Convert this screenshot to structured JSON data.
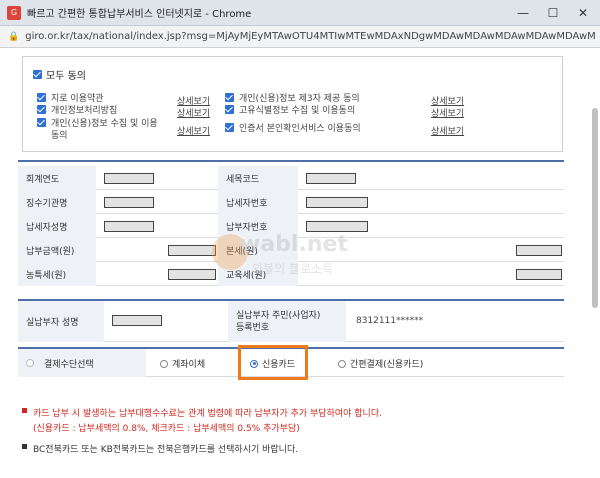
{
  "window": {
    "title": "빠르고 간편한 통합납부서비스 인터넷지로 - Chrome",
    "minimize": "—",
    "maximize": "☐",
    "close": "✕"
  },
  "address_bar": {
    "url": "giro.or.kr/tax/national/index.jsp?msg=MjAyMjEyMTAwOTU4MTIwMTEwMDAxNDgwMDAwMDAwMDAwMDAwMDAwMDAw..."
  },
  "agreement": {
    "all_label": "모두 동의",
    "detail_label": "상세보기",
    "terms_left": [
      "지로 이용약관",
      "개인정보처리방침",
      "개인(신용)정보 수집 및 이용\n동의"
    ],
    "terms_right": [
      "개인(신용)정보 제3자 제공 동의",
      "고유식별정보 수집 및 이용동의",
      "인증서 본인확인서비스 이용동의"
    ]
  },
  "info": {
    "fiscal_year": "회계연도",
    "tax_code": "세목코드",
    "collecting_org": "징수기관명",
    "taxpayer_no": "납세자번호",
    "taxpayer_name": "납세자성명",
    "payment_no": "납부자번호",
    "amount": "납부금액(원)",
    "principal_tax": "본세(원)",
    "rural_tax": "농특세(원)",
    "education_tax": "교육세(원)"
  },
  "payer": {
    "name_label": "실납부자 성명",
    "id_label": "실납부자 주민(사업자)\n등록번호",
    "id_value": "8312111******"
  },
  "payment_method": {
    "label": "결제수단선택",
    "options": [
      "계좌이체",
      "신용카드",
      "간편결제(신용카드)"
    ],
    "selected": "신용카드"
  },
  "notes": {
    "line1": "카드 납부 시 발생하는 납부대행수수료는 관계 법령에 따라 납부자가 추가 부담하여야 합니다.",
    "line2": "(신용카드 : 납부세액의 0.8%, 체크카드 : 납부세액의 0.5% 추가부담)",
    "line3": "BC전북카드 또는 KB전북카드는 전북은행카드를 선택하시기 바랍니다."
  },
  "watermark": {
    "main": "wabl.net",
    "sub": "와블의 블로소득"
  },
  "colors": {
    "accent_blue": "#4d6ea8",
    "highlight_orange": "#f07a1a",
    "warning_red": "#d0281e"
  }
}
